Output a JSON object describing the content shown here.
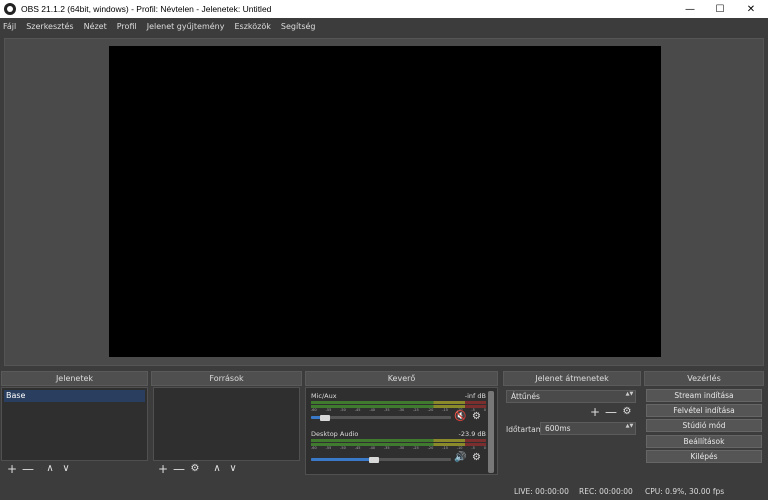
{
  "window": {
    "title": "OBS 21.1.2 (64bit, windows) - Profil: Névtelen - Jelenetek: Untitled",
    "minimize": "—",
    "maximize": "☐",
    "close": "✕"
  },
  "menu": [
    "Fájl",
    "Szerkesztés",
    "Nézet",
    "Profil",
    "Jelenet gyűjtemény",
    "Eszközök",
    "Segítség"
  ],
  "docks": {
    "scenes": {
      "title": "Jelenetek",
      "items": [
        "Base"
      ]
    },
    "sources": {
      "title": "Források"
    },
    "mixer": {
      "title": "Keverő",
      "channels": [
        {
          "name": "Mic/Aux",
          "db": "-inf dB",
          "volume_fraction": 0.1,
          "muted": true
        },
        {
          "name": "Desktop Audio",
          "db": "-23.9 dB",
          "volume_fraction": 0.45,
          "muted": false
        }
      ],
      "ticks": [
        "-60",
        "-55",
        "-50",
        "-45",
        "-40",
        "-35",
        "-30",
        "-25",
        "-20",
        "-15",
        "-10",
        "-5",
        "0"
      ]
    },
    "transitions": {
      "title": "Jelenet átmenetek",
      "selected": "Áttűnés",
      "duration_label": "Időtartam",
      "duration_value": "600ms"
    },
    "controls": {
      "title": "Vezérlés",
      "buttons": [
        "Stream indítása",
        "Felvétel indítása",
        "Stúdió mód",
        "Beállítások",
        "Kilépés"
      ]
    }
  },
  "icons": {
    "add": "+",
    "remove": "—",
    "gear": "⚙",
    "up": "∧",
    "down": "∨",
    "speaker": "🔊",
    "speaker_muted": "🔇",
    "spin": "▲▼"
  },
  "status": {
    "live": "LIVE: 00:00:00",
    "rec": "REC: 00:00:00",
    "cpu": "CPU: 0.9%, 30.00 fps"
  }
}
